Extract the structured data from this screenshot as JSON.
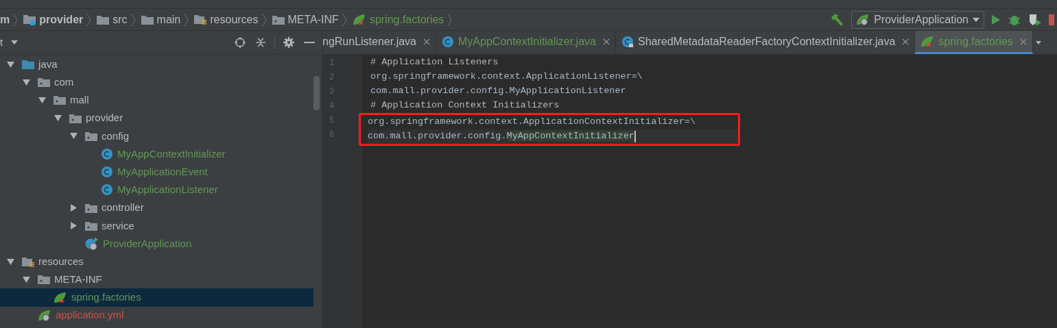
{
  "breadcrumbs": [
    {
      "label": "m",
      "kind": "text"
    },
    {
      "label": "provider",
      "kind": "module"
    },
    {
      "label": "src",
      "kind": "folder"
    },
    {
      "label": "main",
      "kind": "folder"
    },
    {
      "label": "resources",
      "kind": "resources"
    },
    {
      "label": "META-INF",
      "kind": "package"
    },
    {
      "label": "spring.factories",
      "kind": "spring"
    }
  ],
  "run_config": {
    "label": "ProviderApplication"
  },
  "project_panel": {
    "title": "t"
  },
  "tree": [
    {
      "label": "java",
      "kind": "source",
      "expanded": true,
      "selected": false,
      "children": [
        {
          "label": "com",
          "kind": "package",
          "expanded": true,
          "selected": false,
          "children": [
            {
              "label": "mall",
              "kind": "package",
              "expanded": true,
              "selected": false,
              "children": [
                {
                  "label": "provider",
                  "kind": "package",
                  "expanded": true,
                  "selected": false,
                  "children": [
                    {
                      "label": "config",
                      "kind": "package",
                      "expanded": true,
                      "selected": false,
                      "children": [
                        {
                          "label": "MyAppContextInitializer",
                          "kind": "class",
                          "selected": false,
                          "color": "#629755"
                        },
                        {
                          "label": "MyApplicationEvent",
                          "kind": "class",
                          "selected": false,
                          "color": "#629755"
                        },
                        {
                          "label": "MyApplicationListener",
                          "kind": "class",
                          "selected": false,
                          "color": "#629755"
                        }
                      ]
                    },
                    {
                      "label": "controller",
                      "kind": "package",
                      "expanded": false,
                      "selected": false
                    },
                    {
                      "label": "service",
                      "kind": "package",
                      "expanded": false,
                      "selected": false
                    },
                    {
                      "label": "ProviderApplication",
                      "kind": "app",
                      "selected": false,
                      "color": "#629755"
                    }
                  ]
                }
              ]
            }
          ]
        }
      ]
    },
    {
      "label": "resources",
      "kind": "resources",
      "expanded": true,
      "selected": false,
      "children": [
        {
          "label": "META-INF",
          "kind": "package",
          "expanded": true,
          "selected": false,
          "children": [
            {
              "label": "spring.factories",
              "kind": "spring",
              "selected": true,
              "color": "#629755"
            }
          ]
        },
        {
          "label": "application.yml",
          "kind": "yml",
          "selected": false,
          "color": "#c75450"
        }
      ]
    }
  ],
  "tabs": [
    {
      "label": "ngRunListener.java",
      "kind": "cut",
      "selected": false
    },
    {
      "label": "MyAppContextInitializer.java",
      "kind": "class",
      "selected": false
    },
    {
      "label": "SharedMetadataReaderFactoryContextInitializer.java",
      "kind": "locked-class",
      "selected": false
    },
    {
      "label": "spring.factories",
      "kind": "spring",
      "selected": true
    }
  ],
  "editor": {
    "lines": [
      {
        "number": "1",
        "kind": "comment",
        "current": false,
        "boxed": false,
        "segments": [
          {
            "text": "# Application Listeners",
            "highlight": false
          }
        ]
      },
      {
        "number": "2",
        "kind": "plain",
        "current": false,
        "boxed": false,
        "segments": [
          {
            "text": "org.springframework.context.ApplicationListener=\\",
            "highlight": false
          }
        ]
      },
      {
        "number": "3",
        "kind": "plain",
        "current": false,
        "boxed": false,
        "segments": [
          {
            "text": "com.mall.provider.config.MyApplicationListener",
            "highlight": false
          }
        ]
      },
      {
        "number": "4",
        "kind": "comment",
        "current": false,
        "boxed": false,
        "segments": [
          {
            "text": "# Application Context Initializers",
            "highlight": false
          }
        ]
      },
      {
        "number": "5",
        "kind": "plain",
        "current": false,
        "boxed": true,
        "segments": [
          {
            "text": "org.springframework.context.ApplicationContextInitializer=\\",
            "highlight": false
          }
        ]
      },
      {
        "number": "6",
        "kind": "plain",
        "current": true,
        "boxed": true,
        "segments": [
          {
            "text": "com.mall.provider.config.",
            "highlight": false
          },
          {
            "text": "MyAppContextInitializer",
            "highlight": true
          }
        ]
      }
    ]
  }
}
